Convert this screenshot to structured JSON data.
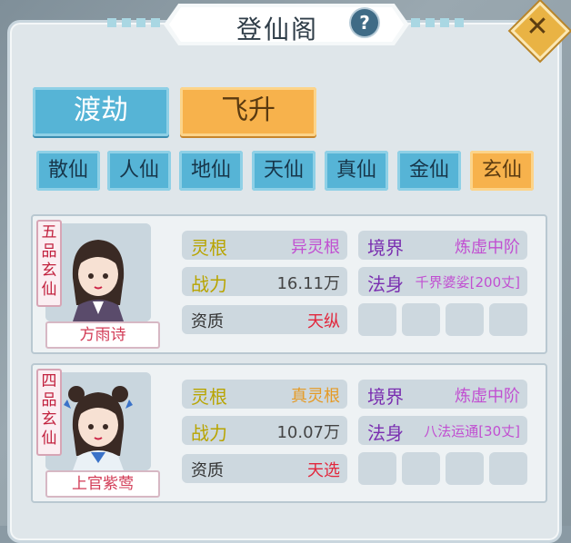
{
  "title": "登仙阁",
  "help_label": "?",
  "close_label": "✕",
  "tabs": [
    {
      "label": "渡劫",
      "active": false
    },
    {
      "label": "飞升",
      "active": true
    }
  ],
  "ranks": [
    {
      "label": "散仙",
      "active": false
    },
    {
      "label": "人仙",
      "active": false
    },
    {
      "label": "地仙",
      "active": false
    },
    {
      "label": "天仙",
      "active": false
    },
    {
      "label": "真仙",
      "active": false
    },
    {
      "label": "金仙",
      "active": false
    },
    {
      "label": "玄仙",
      "active": true
    }
  ],
  "characters": [
    {
      "rank_tag": "五品玄仙",
      "name": "方雨诗",
      "root_label": "灵根",
      "root_value": "异灵根",
      "root_color": "#c14fd1",
      "realm_label": "境界",
      "realm_value": "炼虚中阶",
      "power_label": "战力",
      "power_value": "16.11万",
      "body_label": "法身",
      "body_value": "千界婆娑[200丈]",
      "aptitude_label": "资质",
      "aptitude_value": "天纵",
      "slots": 4
    },
    {
      "rank_tag": "四品玄仙",
      "name": "上官紫莺",
      "root_label": "灵根",
      "root_value": "真灵根",
      "root_color": "#e59a25",
      "realm_label": "境界",
      "realm_value": "炼虚中阶",
      "power_label": "战力",
      "power_value": "10.07万",
      "body_label": "法身",
      "body_value": "八法运通[30丈]",
      "aptitude_label": "资质",
      "aptitude_value": "天选",
      "slots": 4
    }
  ],
  "colors": {
    "accent_blue": "#56b4d6",
    "accent_orange": "#f7b24c",
    "value_purple": "#c14fd1",
    "value_red": "#e2263c",
    "label_gold": "#b8a400",
    "label_purple": "#7a2fb0"
  }
}
